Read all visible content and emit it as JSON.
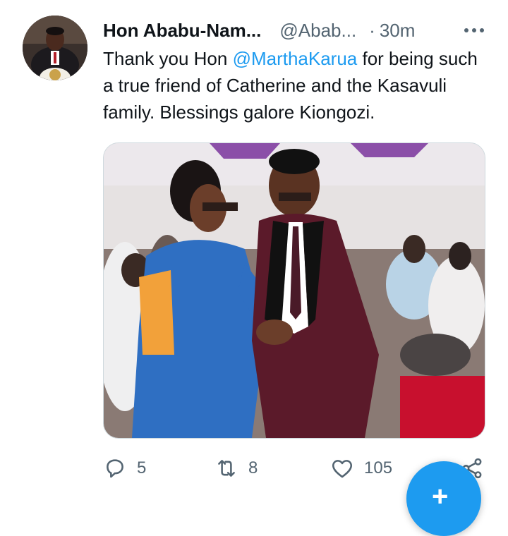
{
  "tweet": {
    "display_name": "Hon Ababu-Nam...",
    "handle": "@Abab...",
    "separator": "·",
    "time": "30m",
    "text_before": "Thank you Hon ",
    "mention": "@MarthaKarua",
    "text_after": " for being such a true friend of Catherine and the Kasavuli family. Blessings galore Kiongozi."
  },
  "actions": {
    "replies": "5",
    "retweets": "8",
    "likes": "105"
  },
  "icons": {
    "more": "more-horizontal-icon",
    "reply": "reply-icon",
    "retweet": "retweet-icon",
    "like": "heart-icon",
    "share": "share-icon",
    "compose": "compose-icon"
  },
  "colors": {
    "accent": "#1d9bf0",
    "secondary_text": "#536471"
  }
}
